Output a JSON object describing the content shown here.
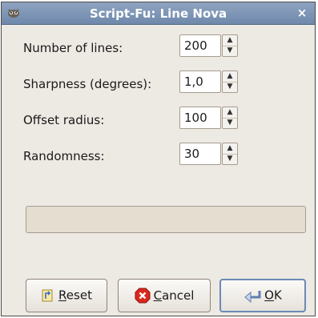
{
  "window": {
    "title": "Script-Fu: Line Nova",
    "close_glyph": "×"
  },
  "fields": [
    {
      "label": "Number of lines:",
      "value": "200"
    },
    {
      "label": "Sharpness (degrees):",
      "value": "1,0"
    },
    {
      "label": "Offset radius:",
      "value": "100"
    },
    {
      "label": "Randomness:",
      "value": "30"
    }
  ],
  "progress": {
    "value": 0
  },
  "buttons": {
    "reset": {
      "mnemonic": "R",
      "rest": "eset",
      "icon": "reset-icon"
    },
    "cancel": {
      "mnemonic": "C",
      "rest": "ancel",
      "icon": "cancel-icon"
    },
    "ok": {
      "mnemonic": "O",
      "rest": "K",
      "icon": "ok-icon"
    }
  },
  "colors": {
    "titlebar": "#7a92b3",
    "window_bg": "#ede9e3",
    "ok_border": "#6a8bb5",
    "cancel_icon": "#d9281f"
  }
}
